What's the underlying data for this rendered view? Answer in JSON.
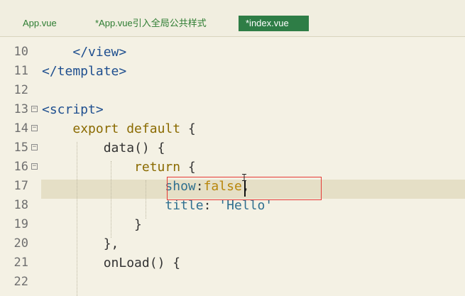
{
  "tabs": [
    {
      "label": "App.vue",
      "active": false
    },
    {
      "label": "*App.vue引入全局公共样式",
      "active": false
    },
    {
      "label": "*index.vue",
      "active": true
    }
  ],
  "editor": {
    "lines": [
      {
        "num": "10",
        "fold": "",
        "tokens": [
          {
            "t": "    "
          },
          {
            "t": "</view>",
            "c": "tag"
          }
        ]
      },
      {
        "num": "11",
        "fold": "",
        "tokens": [
          {
            "t": "</template>",
            "c": "tag"
          }
        ]
      },
      {
        "num": "12",
        "fold": "",
        "tokens": []
      },
      {
        "num": "13",
        "fold": "⊟",
        "tokens": [
          {
            "t": "<script>",
            "c": "tag"
          }
        ]
      },
      {
        "num": "14",
        "fold": "⊟",
        "tokens": [
          {
            "t": "    "
          },
          {
            "t": "export default",
            "c": "kw"
          },
          {
            "t": " {",
            "c": "punc"
          }
        ]
      },
      {
        "num": "15",
        "fold": "⊟",
        "tokens": [
          {
            "t": "        "
          },
          {
            "t": "data",
            "c": "fn"
          },
          {
            "t": "() {",
            "c": "punc"
          }
        ]
      },
      {
        "num": "16",
        "fold": "⊟",
        "tokens": [
          {
            "t": "            "
          },
          {
            "t": "return",
            "c": "kw"
          },
          {
            "t": " {",
            "c": "punc"
          }
        ]
      },
      {
        "num": "17",
        "fold": "",
        "tokens": [
          {
            "t": "                "
          },
          {
            "t": "show",
            "c": "prop"
          },
          {
            "t": ":",
            "c": "punc"
          },
          {
            "t": "false",
            "c": "bool"
          },
          {
            "t": ",",
            "c": "punc"
          }
        ]
      },
      {
        "num": "18",
        "fold": "",
        "tokens": [
          {
            "t": "                "
          },
          {
            "t": "title",
            "c": "prop"
          },
          {
            "t": ": ",
            "c": "punc"
          },
          {
            "t": "'Hello'",
            "c": "str"
          }
        ]
      },
      {
        "num": "19",
        "fold": "",
        "tokens": [
          {
            "t": "            "
          },
          {
            "t": "}",
            "c": "punc"
          }
        ]
      },
      {
        "num": "20",
        "fold": "",
        "tokens": [
          {
            "t": "        "
          },
          {
            "t": "},",
            "c": "punc"
          }
        ]
      },
      {
        "num": "21",
        "fold": "",
        "tokens": [
          {
            "t": "        "
          },
          {
            "t": "onLoad",
            "c": "fn"
          },
          {
            "t": "() {",
            "c": "punc"
          }
        ]
      },
      {
        "num": "22",
        "fold": "",
        "tokens": []
      }
    ]
  },
  "colors": {
    "background": "#F4F1E4",
    "active_tab": "#2E7D46",
    "tab_text": "#2E7D32",
    "highlight_border": "#E53935",
    "current_line": "#E5DFC6"
  }
}
